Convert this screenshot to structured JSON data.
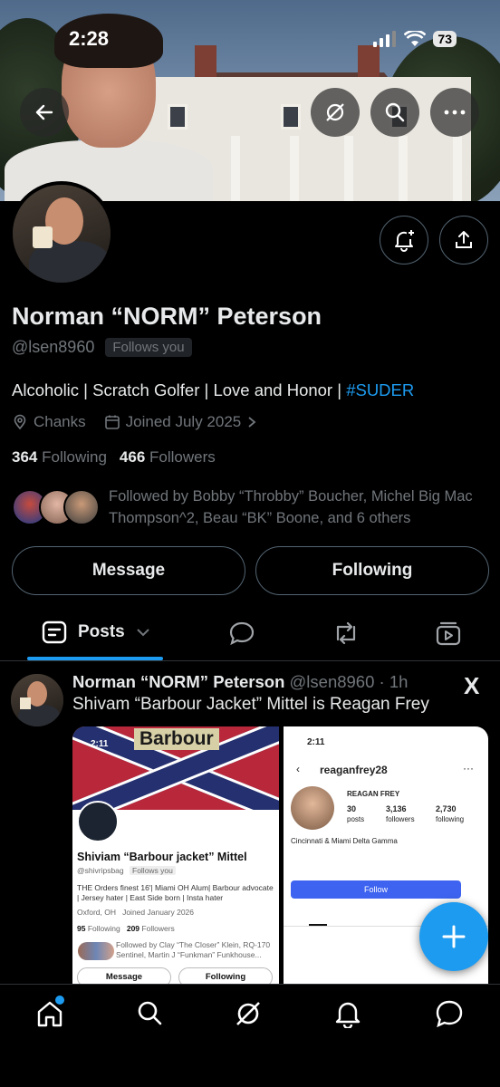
{
  "status": {
    "time": "2:28",
    "battery": "73"
  },
  "profile": {
    "name": "Norman “NORM” Peterson",
    "handle": "@lsen8960",
    "follows_badge": "Follows you",
    "bio_text": "Alcoholic | Scratch Golfer | Love and Honor | ",
    "bio_tag": "#SUDER",
    "location": "Chanks",
    "joined": "Joined July 2025",
    "following_count": "364",
    "following_label": "Following",
    "followers_count": "466",
    "followers_label": "Followers",
    "followed_by": "Followed by Bobby “Throbby” Boucher, Michel Big Mac Thompson^2, Beau “BK” Boone, and 6 others",
    "message_label": "Message",
    "following_button_label": "Following"
  },
  "tabs": {
    "posts_label": "Posts"
  },
  "post": {
    "author_name": "Norman “NORM” Peterson",
    "author_meta": " @lsen8960 · 1h",
    "text": "Shivam “Barbour Jacket” Mittel is Reagan Frey",
    "x_logo": "X",
    "shot1": {
      "time": "2:11",
      "banner_text": "Barbour",
      "name": "Shiviam “Barbour jacket” Mittel",
      "handle": "@shivripsbag",
      "follows": "Follows you",
      "bio": "THE Orders finest 16'| Miami OH Alum| Barbour advocate | Jersey hater | East Side born | Insta hater",
      "location": "Oxford, OH",
      "joined": "Joined January 2026",
      "following_count": "95",
      "following_label": "Following",
      "followers_count": "209",
      "followers_label": "Followers",
      "followed_by": "Followed by Clay “The Closer” Klein, RQ-170 Sentinel, Martin J “Funkman” Funkhouse...",
      "message": "Message",
      "following": "Following"
    },
    "shot2": {
      "time": "2:11",
      "username": "reaganfrey28",
      "display_name": "REAGAN FREY",
      "posts_count": "30",
      "posts_label": "posts",
      "followers_count": "3,136",
      "followers_label": "followers",
      "following_count": "2,730",
      "following_label": "following",
      "bio": "Cincinnati & Miami Delta Gamma",
      "follow_button": "Follow"
    }
  },
  "colors": {
    "accent": "#1d9bf0",
    "muted": "#71767b",
    "border": "#536471"
  }
}
